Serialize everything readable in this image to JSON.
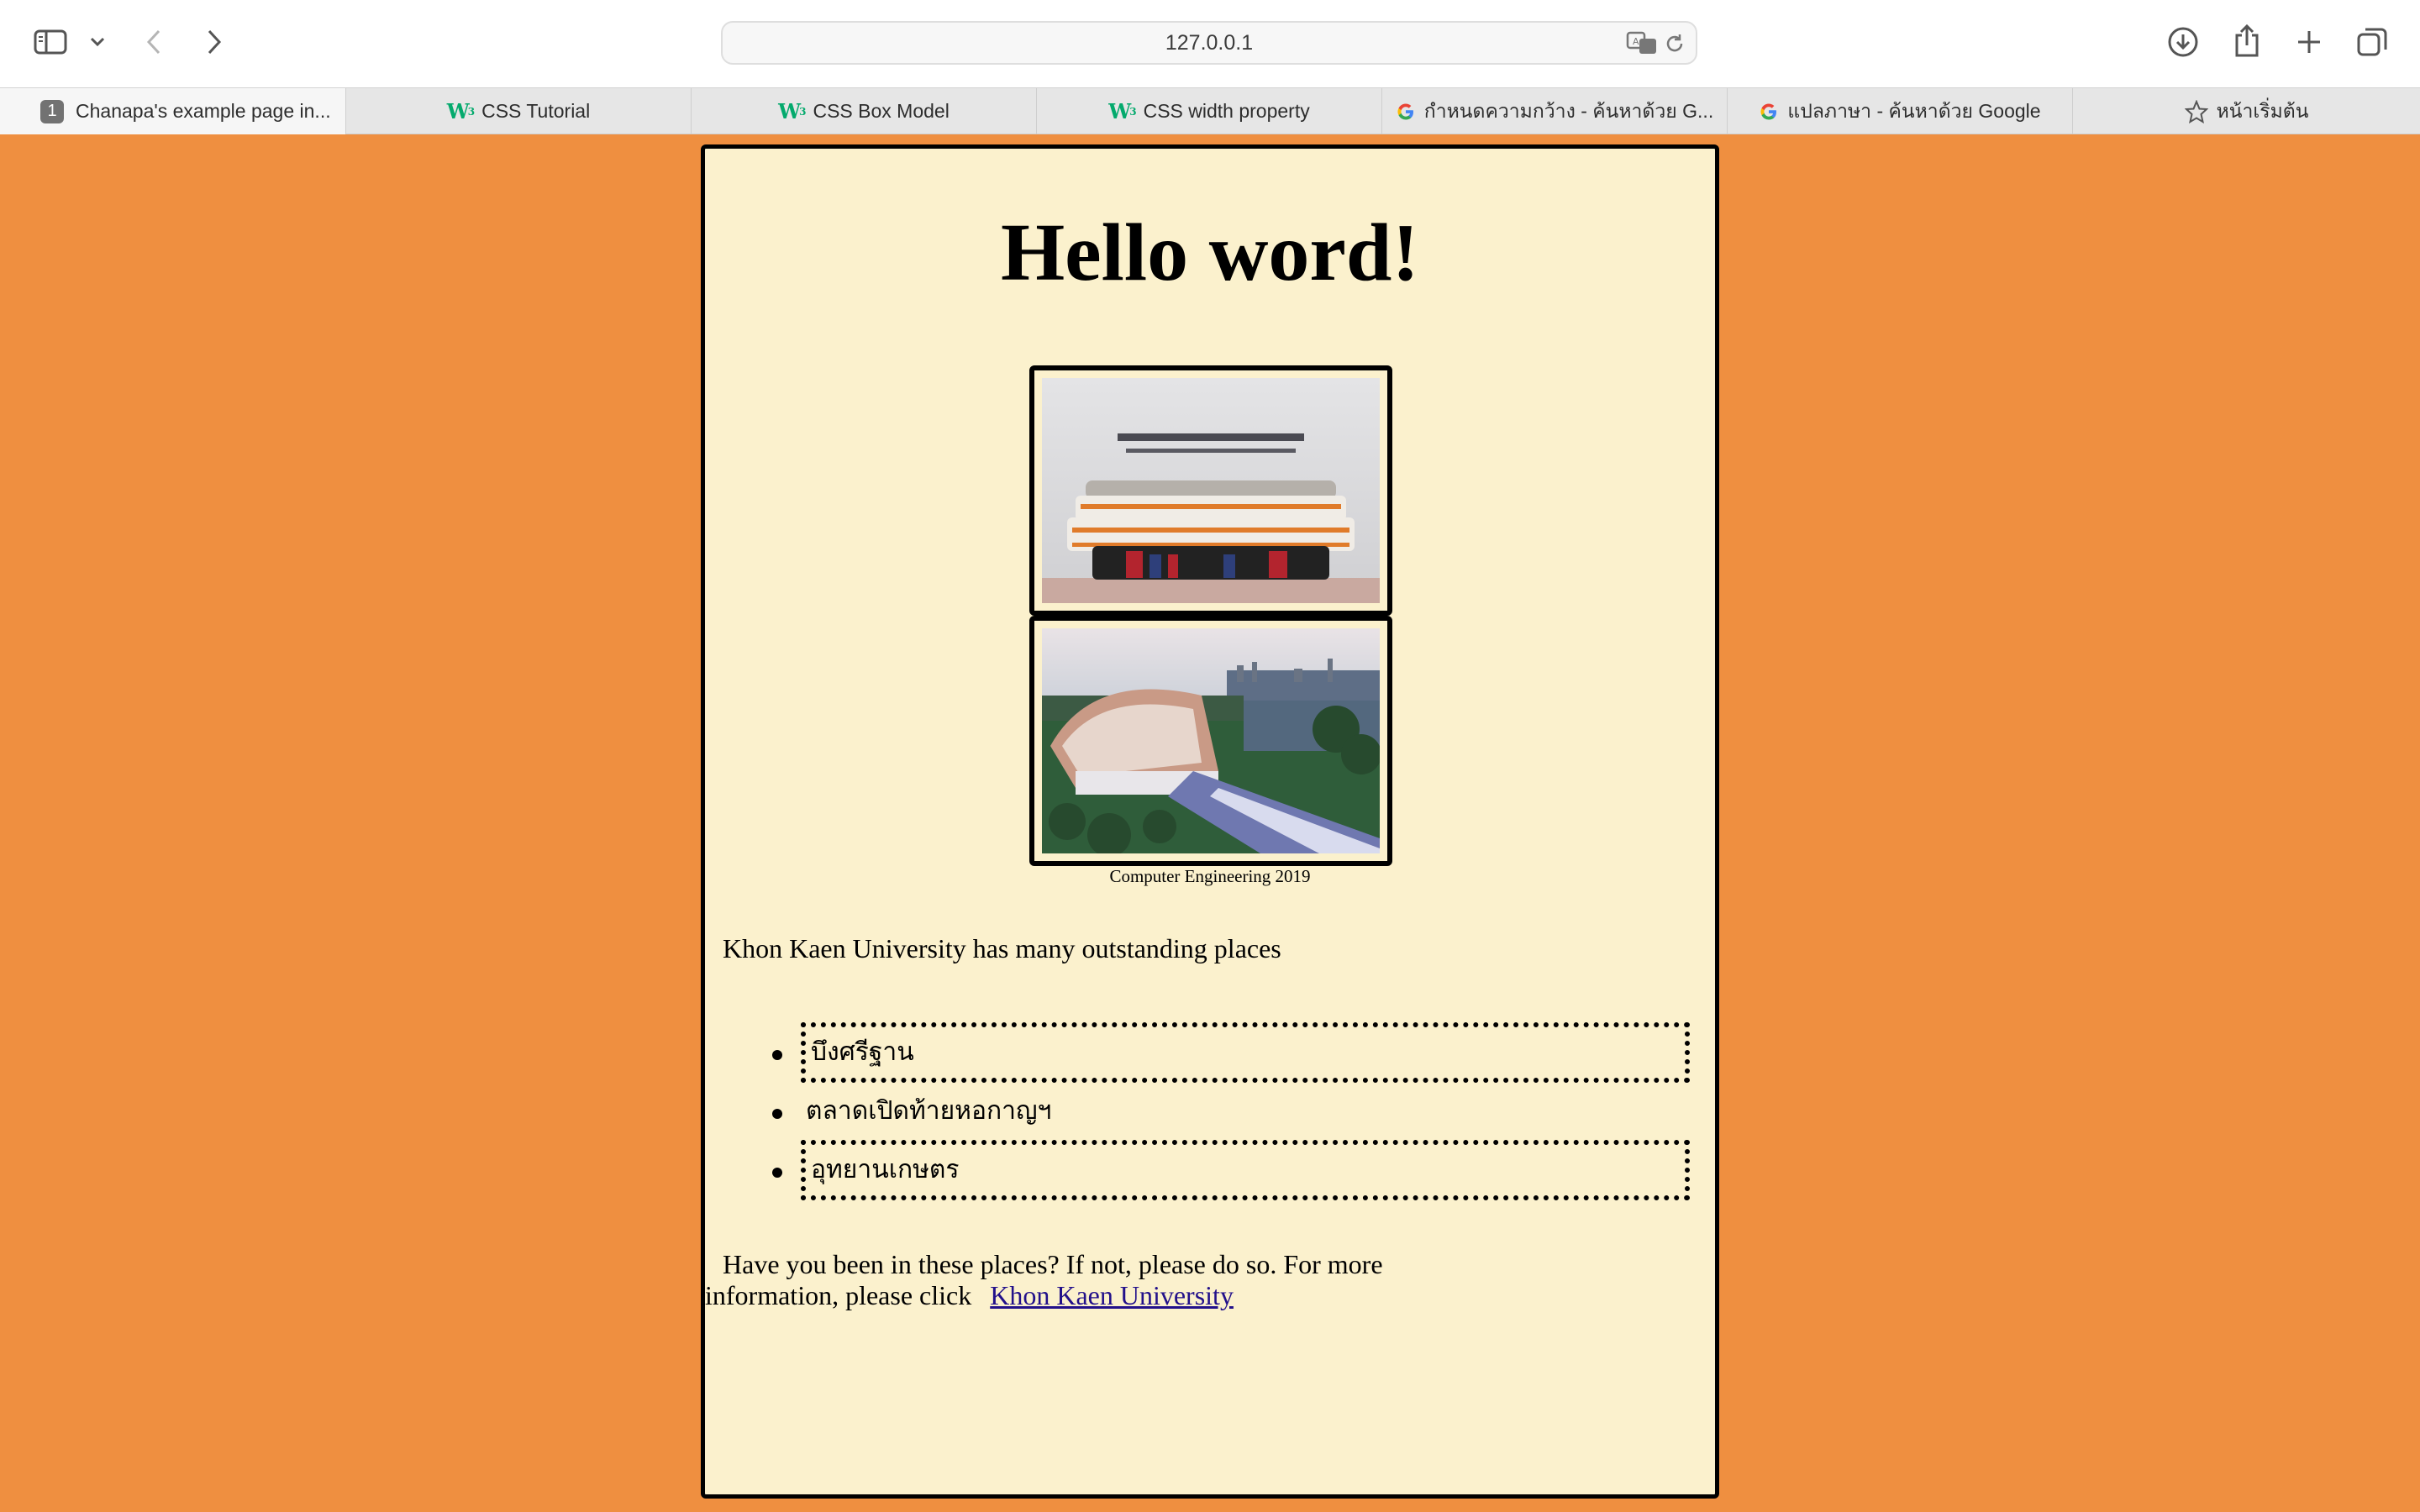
{
  "browser": {
    "url": "127.0.0.1",
    "tabs": [
      {
        "label": "Chanapa's example page in...",
        "badge": "1",
        "icon": "page-number-badge",
        "active": true
      },
      {
        "label": "CSS Tutorial",
        "icon": "w3schools-icon"
      },
      {
        "label": "CSS Box Model",
        "icon": "w3schools-icon"
      },
      {
        "label": "CSS width property",
        "icon": "w3schools-icon"
      },
      {
        "label": "กำหนดความกว้าง - ค้นหาด้วย G...",
        "icon": "google-icon"
      },
      {
        "label": "แปลภาษา - ค้นหาด้วย Google",
        "icon": "google-icon"
      },
      {
        "label": "หน้าเริ่มต้น",
        "icon": "star-icon"
      }
    ]
  },
  "page": {
    "background": "#ef8f40",
    "card_background": "#fbf1cd",
    "title": "Hello word!",
    "photo_caption": "Computer Engineering 2019",
    "intro": "Khon Kaen University has many outstanding places",
    "places": [
      {
        "label": "บึงศรีฐาน",
        "boxed": true
      },
      {
        "label": "ตลาดเปิดท้ายหอกาญฯ",
        "boxed": false
      },
      {
        "label": "อุทยานเกษตร",
        "boxed": true
      }
    ],
    "footer_line1": "Have you been in these places? If not, please do so. For more",
    "footer_line2": "information, please click",
    "link_text": "Khon Kaen University"
  }
}
